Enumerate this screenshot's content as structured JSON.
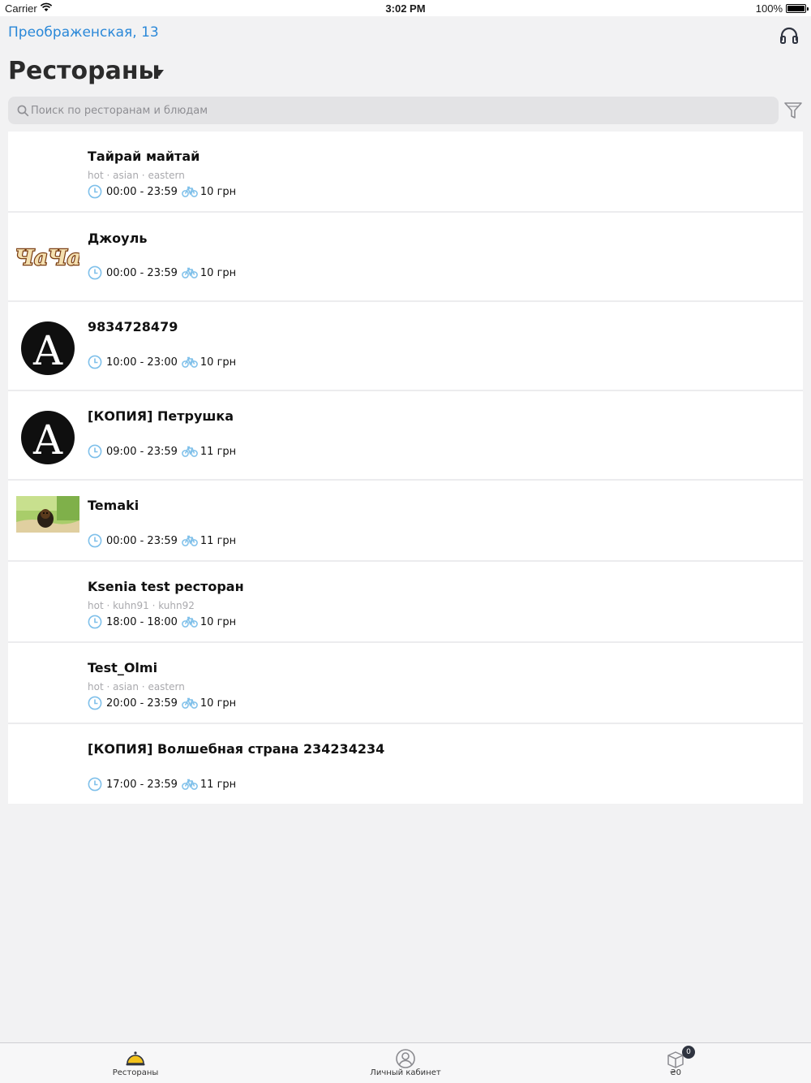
{
  "status_bar": {
    "carrier": "Carrier",
    "time": "3:02 PM",
    "battery": "100%"
  },
  "header": {
    "address": "Преображенская, 13",
    "title": "Рестораны",
    "search_placeholder": "Поиск по ресторанам и блюдам"
  },
  "restaurants": [
    {
      "name": "Тайрай майтай",
      "tags": "hot · asian · eastern",
      "hours": "00:00 - 23:59",
      "delivery": "10 грн",
      "logo": "none"
    },
    {
      "name": "Джоуль",
      "tags": "",
      "hours": "00:00 - 23:59",
      "delivery": "10 грн",
      "logo": "chacha-logo",
      "logo_text": "ЧаЧа"
    },
    {
      "name": "9834728479",
      "tags": "",
      "hours": "10:00 - 23:00",
      "delivery": "10 грн",
      "logo": "letter-a-logo",
      "logo_text": "A"
    },
    {
      "name": "[КОПИЯ] Петрушка",
      "tags": "",
      "hours": "09:00 - 23:59",
      "delivery": "11 грн",
      "logo": "letter-a-logo",
      "logo_text": "A"
    },
    {
      "name": "Temaki",
      "tags": "",
      "hours": "00:00 - 23:59",
      "delivery": "11 грн",
      "logo": "dog-photo"
    },
    {
      "name": "Ksenia test ресторан",
      "tags": "hot · kuhn91 · kuhn92",
      "hours": "18:00 - 18:00",
      "delivery": "10 грн",
      "logo": "none"
    },
    {
      "name": "Test_Olmi",
      "tags": "hot · asian · eastern",
      "hours": "20:00 - 23:59",
      "delivery": "10 грн",
      "logo": "none"
    },
    {
      "name": "[КОПИЯ] Волшебная страна 234234234",
      "tags": "",
      "hours": "17:00 - 23:59",
      "delivery": "11 грн",
      "logo": "none"
    }
  ],
  "tabbar": {
    "restaurants_label": "Рестораны",
    "cabinet_label": "Личный кабинет",
    "cart_label": "₴0",
    "cart_badge": "0"
  },
  "colors": {
    "accent": "#2a88d8",
    "icon_blue": "#7fc0ea",
    "tab_active": "#f3c21b"
  }
}
